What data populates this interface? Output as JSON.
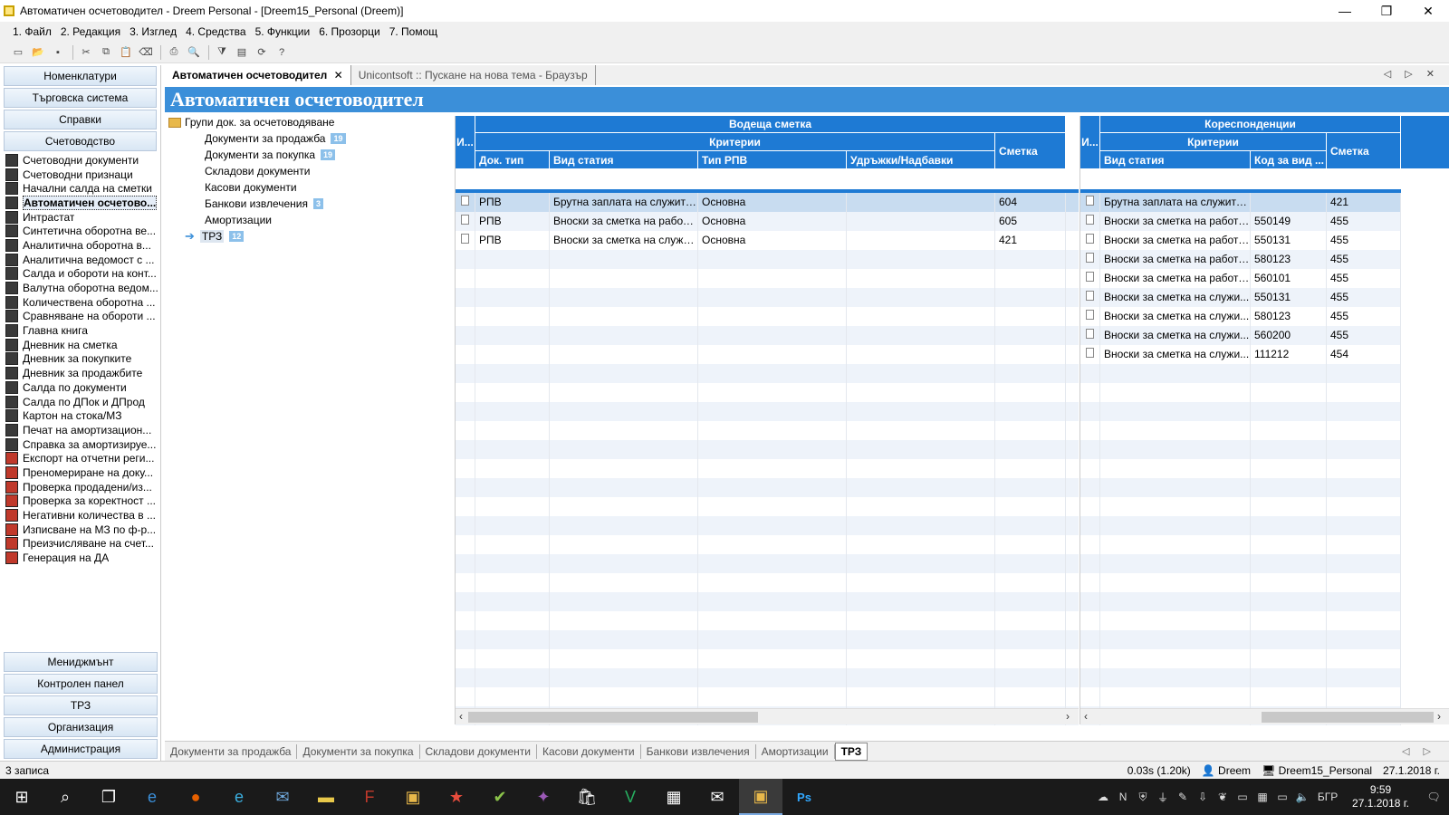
{
  "window": {
    "title": "Автоматичен осчетоводител - Dreem Personal - [Dreem15_Personal (Dreem)]",
    "minimize": "—",
    "restore": "❐",
    "close": "✕"
  },
  "menu": [
    "1. Файл",
    "2. Редакция",
    "3. Изглед",
    "4. Средства",
    "5. Функции",
    "6. Прозорци",
    "7. Помощ"
  ],
  "sidebar": {
    "top_buttons": [
      "Номенклатури",
      "Търговска система",
      "Справки",
      "Счетоводство"
    ],
    "items": [
      {
        "label": "Счетоводни документи",
        "icon": "ledger-icon"
      },
      {
        "label": "Счетоводни признаци",
        "icon": "ledger-icon"
      },
      {
        "label": "Начални салда на сметки",
        "icon": "ledger-icon"
      },
      {
        "label": "Автоматичен осчетово...",
        "icon": "ledger-icon",
        "selected": true
      },
      {
        "label": "Интрастат",
        "icon": "ledger-icon"
      },
      {
        "label": "Синтетична оборотна ве...",
        "icon": "report-icon"
      },
      {
        "label": "Аналитична оборотна в...",
        "icon": "report-icon"
      },
      {
        "label": "Аналитична ведомост с ...",
        "icon": "report-icon"
      },
      {
        "label": "Салда и обороти на конт...",
        "icon": "report-icon"
      },
      {
        "label": "Валутна оборотна ведом...",
        "icon": "report-icon"
      },
      {
        "label": "Количествена оборотна ...",
        "icon": "report-icon"
      },
      {
        "label": "Сравняване на обороти ...",
        "icon": "report-icon"
      },
      {
        "label": "Главна книга",
        "icon": "report-icon"
      },
      {
        "label": "Дневник на сметка",
        "icon": "report-icon"
      },
      {
        "label": "Дневник за покупките",
        "icon": "report-icon"
      },
      {
        "label": "Дневник за продажбите",
        "icon": "report-icon"
      },
      {
        "label": "Салда по документи",
        "icon": "report-icon"
      },
      {
        "label": "Салда по ДПок и ДПрод",
        "icon": "report-icon"
      },
      {
        "label": "Картон на стока/МЗ",
        "icon": "report-icon"
      },
      {
        "label": "Печат на амортизацион...",
        "icon": "report-icon"
      },
      {
        "label": "Справка за амортизируе...",
        "icon": "report-icon"
      },
      {
        "label": "Експорт на отчетни реги...",
        "icon": "tool-icon"
      },
      {
        "label": "Преномериране на доку...",
        "icon": "tool-icon"
      },
      {
        "label": "Проверка продадени/из...",
        "icon": "tool-icon"
      },
      {
        "label": "Проверка за коректност ...",
        "icon": "tool-icon"
      },
      {
        "label": "Негативни количества в ...",
        "icon": "tool-icon"
      },
      {
        "label": "Изписване на МЗ по ф-р...",
        "icon": "tool-icon"
      },
      {
        "label": "Преизчисляване на счет...",
        "icon": "tool-icon"
      },
      {
        "label": "Генерация на ДА",
        "icon": "tool-icon"
      }
    ],
    "bottom_buttons": [
      "Мениджмънт",
      "Контролен панел",
      "ТРЗ",
      "Организация",
      "Администрация"
    ]
  },
  "doc_tabs": [
    {
      "label": "Автоматичен осчетоводител",
      "active": true,
      "close": "✕"
    },
    {
      "label": "Unicontsoft :: Пускане на нова тема - Браузър",
      "active": false
    }
  ],
  "doc_tab_controls": "◁ ▷ ✕",
  "page_title": "Автоматичен осчетоводител",
  "tree": {
    "root": "Групи док. за осчетоводяване",
    "children": [
      {
        "label": "Документи за продажба",
        "badge": "19"
      },
      {
        "label": "Документи за покупка",
        "badge": "19"
      },
      {
        "label": "Складови документи",
        "badge": ""
      },
      {
        "label": "Касови документи",
        "badge": ""
      },
      {
        "label": "Банкови извлечения",
        "badge": "3"
      },
      {
        "label": "Амортизации",
        "badge": ""
      },
      {
        "label": "ТРЗ",
        "badge": "12",
        "selected": true
      }
    ]
  },
  "grid_left": {
    "group_title": "Водеща сметка",
    "criteria_title": "Критерии",
    "col_i": "И...",
    "columns": [
      "Док. тип",
      "Вид статия",
      "Тип РПВ",
      "Удръжки/Надбавки"
    ],
    "col_account": "Сметка",
    "rows": [
      {
        "doc_type": "РПВ",
        "article": "Брутна заплата на служители",
        "rpv": "Основна",
        "deduct": "",
        "account": "604"
      },
      {
        "doc_type": "РПВ",
        "article": "Вноски за сметка на работо...",
        "rpv": "Основна",
        "deduct": "",
        "account": "605"
      },
      {
        "doc_type": "РПВ",
        "article": "Вноски за сметка на служи...",
        "rpv": "Основна",
        "deduct": "",
        "account": "421"
      }
    ]
  },
  "grid_right": {
    "group_title": "Кореспонденции",
    "criteria_title": "Критерии",
    "col_i": "И...",
    "columns": [
      "Вид статия",
      "Код за вид ..."
    ],
    "col_account": "Сметка",
    "rows": [
      {
        "article": "Брутна заплата на служители",
        "code": "",
        "account": "421"
      },
      {
        "article": "Вноски за сметка на работо...",
        "code": "550149",
        "account": "455"
      },
      {
        "article": "Вноски за сметка на работо...",
        "code": "550131",
        "account": "455"
      },
      {
        "article": "Вноски за сметка на работо...",
        "code": "580123",
        "account": "455"
      },
      {
        "article": "Вноски за сметка на работо...",
        "code": "560101",
        "account": "455"
      },
      {
        "article": "Вноски за сметка на служи...",
        "code": "550131",
        "account": "455"
      },
      {
        "article": "Вноски за сметка на служи...",
        "code": "580123",
        "account": "455"
      },
      {
        "article": "Вноски за сметка на служи...",
        "code": "560200",
        "account": "455"
      },
      {
        "article": "Вноски за сметка на служи...",
        "code": "111212",
        "account": "454"
      }
    ]
  },
  "bottom_tabs": [
    "Документи за продажба",
    "Документи за покупка",
    "Складови документи",
    "Касови документи",
    "Банкови извлечения",
    "Амортизации",
    "ТРЗ"
  ],
  "bottom_tab_controls": "◁ ▷",
  "status": {
    "records": "3 записа",
    "timing": "0.03s (1.20k)",
    "user": "Dreem",
    "database": "Dreem15_Personal",
    "date": "27.1.2018 г."
  },
  "taskbar": {
    "lang": "БГР",
    "time": "9:59",
    "date": "27.1.2018 г."
  },
  "colors": {
    "accent": "#1e7ad4",
    "banner": "#3b8fd9"
  }
}
